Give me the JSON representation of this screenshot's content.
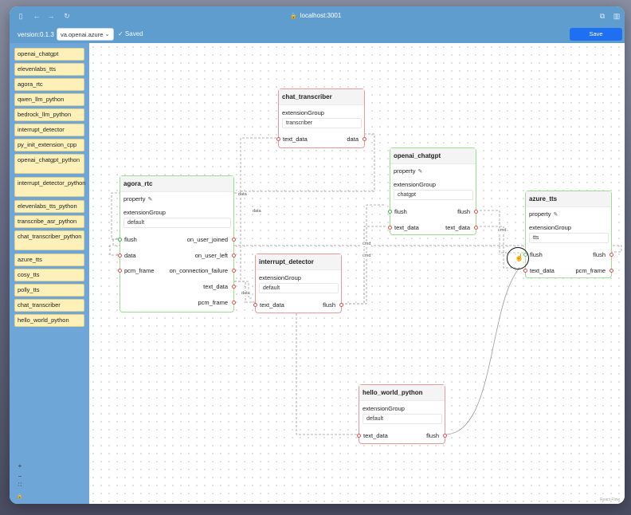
{
  "browser": {
    "url": "localhost:3001"
  },
  "toolbar": {
    "version": "version:0.1.3",
    "graph_select": "va.openai.azure",
    "saved": "✓ Saved",
    "save_label": "Save"
  },
  "sidebar": {
    "items": [
      "openai_chatgpt",
      "elevenlabs_tts",
      "agora_rtc",
      "qwen_llm_python",
      "bedrock_llm_python",
      "interrupt_detector",
      "py_init_extension_cpp",
      "openai_chatgpt_python",
      "interrupt_detector_python",
      "elevenlabs_tts_python",
      "transcribe_asr_python",
      "chat_transcriber_python",
      "azure_tts",
      "cosy_tts",
      "polly_tts",
      "chat_transcriber",
      "hello_world_python"
    ],
    "zoom_in": "+",
    "zoom_out": "−",
    "fit": "⛶",
    "lock": "🔒"
  },
  "labels": {
    "property": "property",
    "extension_group": "extensionGroup"
  },
  "nodes": {
    "chat_transcriber": {
      "title": "chat_transcriber",
      "group": "transcriber",
      "in_text_data": "text_data",
      "out_data": "data"
    },
    "openai_chatgpt": {
      "title": "openai_chatgpt",
      "group": "chatgpt",
      "in_flush": "flush",
      "out_flush": "flush",
      "in_text_data": "text_data",
      "out_text_data": "text_data"
    },
    "agora_rtc": {
      "title": "agora_rtc",
      "group": "default",
      "in_flush": "flush",
      "in_data": "data",
      "in_pcm_frame": "pcm_frame",
      "out_on_user_joined": "on_user_joined",
      "out_on_user_left": "on_user_left",
      "out_on_connection_failure": "on_connection_failure",
      "out_text_data": "text_data",
      "out_pcm_frame": "pcm_frame"
    },
    "interrupt_detector": {
      "title": "interrupt_detector",
      "group": "default",
      "in_text_data": "text_data",
      "out_flush": "flush"
    },
    "azure_tts": {
      "title": "azure_tts",
      "group": "tts",
      "in_flush": "flush",
      "in_text_data": "text_data",
      "out_flush": "flush",
      "out_pcm_frame": "pcm_frame"
    },
    "hello_world_python": {
      "title": "hello_world_python",
      "group": "default",
      "in_text_data": "text_data",
      "out_flush": "flush"
    }
  },
  "edge_labels": {
    "data1": "data",
    "data2": "data",
    "data3": "data",
    "cmd1": "cmd",
    "cmd2": "cmd",
    "cmd3": "cmd"
  },
  "watermark": "React Flow",
  "colors": {
    "header": "#5f9dcf",
    "sidebar": "#6fa6d8",
    "sidebar_item": "#fdf0b8",
    "save_button": "#1f6ff2",
    "handle_red": "#e05050",
    "handle_green": "#3bb34a"
  }
}
